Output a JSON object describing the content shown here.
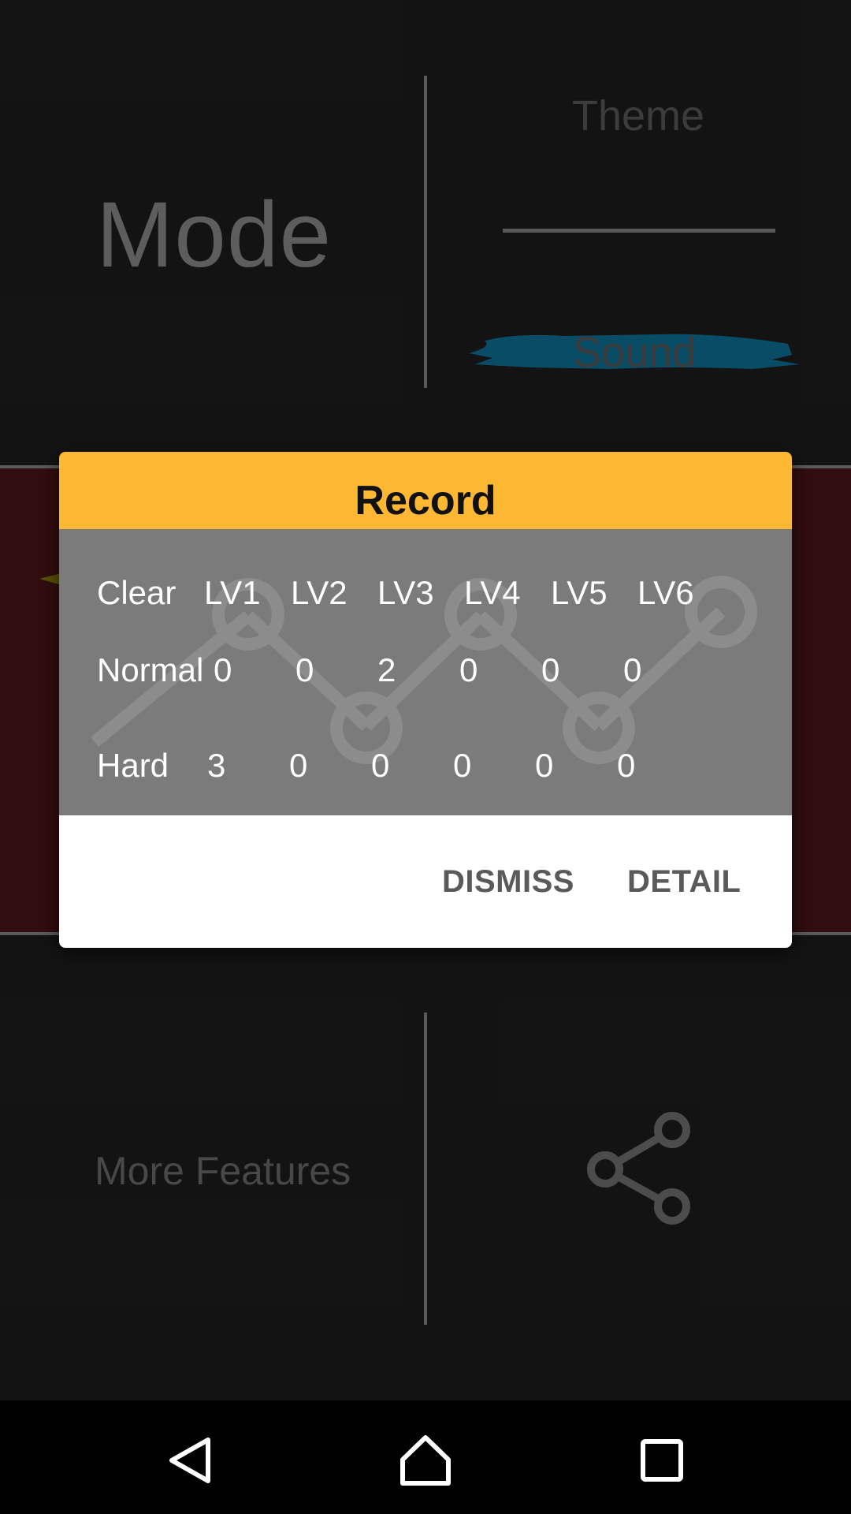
{
  "background": {
    "mode_label": "Mode",
    "theme_label": "Theme",
    "sound_label": "Sound",
    "more_features_label": "More Features",
    "share_icon": "share-icon",
    "colors": {
      "sound_brush": "#0b5a78",
      "mid_band": "#3a1012"
    }
  },
  "dialog": {
    "title": "Record",
    "header_color": "#fdb833",
    "columns": [
      "Clear",
      "LV1",
      "LV2",
      "LV3",
      "LV4",
      "LV5",
      "LV6"
    ],
    "rows": [
      {
        "label": "Normal",
        "values": [
          "0",
          "0",
          "2",
          "0",
          "0",
          "0"
        ]
      },
      {
        "label": "Hard",
        "values": [
          "3",
          "0",
          "0",
          "0",
          "0",
          "0"
        ]
      }
    ],
    "buttons": {
      "dismiss": "DISMISS",
      "detail": "DETAIL"
    }
  },
  "navbar": {
    "back_icon": "back-triangle-icon",
    "home_icon": "home-icon",
    "recents_icon": "recents-square-icon"
  }
}
